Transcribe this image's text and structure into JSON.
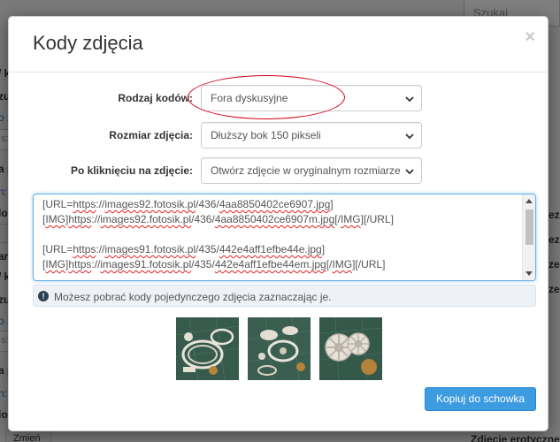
{
  "background": {
    "search_placeholder": "Szukaj",
    "left_items": [
      {
        "text": "/ kod",
        "style": "bold"
      },
      {
        "text": "zuj w",
        "style": "bold"
      },
      {
        "text": "o zd",
        "style": "link"
      },
      {
        "text": "s://w",
        "style": "input"
      },
      {
        "text": "a plik",
        "style": "bold"
      },
      {
        "text": "n: Th",
        "style": "link"
      },
      {
        "text": "loda",
        "style": "bold"
      },
      {
        "text": "Z",
        "style": "plain"
      },
      {
        "text": "ar i",
        "style": "bold"
      },
      {
        "text": "/ ko",
        "style": "bold"
      },
      {
        "text": "zuj w",
        "style": "bold"
      },
      {
        "text": "o zd",
        "style": "link"
      },
      {
        "text": "s://w",
        "style": "input"
      },
      {
        "text": "a plik",
        "style": "bold"
      },
      {
        "text": "n: Th",
        "style": "link"
      },
      {
        "text": "loda",
        "style": "bold"
      },
      {
        "text": "Zmień",
        "style": "button"
      }
    ],
    "right_items": [
      "ez",
      "ezne",
      "ze",
      "ze",
      "Zdjęcie erotyczne"
    ]
  },
  "modal": {
    "title": "Kody zdjęcia",
    "close_label": "×",
    "rows": [
      {
        "label": "Rodzaj kodów:",
        "value": "Fora dyskusyjne"
      },
      {
        "label": "Rozmiar zdjęcia:",
        "value": "Dłuższy bok 150 pikseli"
      },
      {
        "label": "Po kliknięciu na zdjęcie:",
        "value": "Otwórz zdjęcie w oryginalnym rozmiarze"
      }
    ],
    "codes": {
      "lines": [
        [
          "[URL=",
          "https",
          "://",
          "images92.fotosik.pl",
          "/436/",
          "4aa8850402ce6907.jpg",
          "]"
        ],
        [
          "[",
          "IMG",
          "]",
          "https",
          "://",
          "images92.fotosik.pl",
          "/436/",
          "4aa8850402ce6907m.jpg",
          "[/",
          "IMG",
          "][/URL]"
        ],
        [],
        [
          "[URL=",
          "https",
          "://",
          "images91.fotosik.pl",
          "/435/",
          "442e4aff1efbe44e.jpg",
          "]"
        ],
        [
          "[",
          "IMG",
          "]",
          "https",
          "://",
          "images91.fotosik.pl",
          "/435/",
          "442e4aff1efbe44em.jpg",
          "[/",
          "IMG",
          "][/URL]"
        ]
      ]
    },
    "info_icon": "exclamation-icon",
    "info_text": "Możesz pobrać kody pojedynczego zdjęcia zaznaczając je.",
    "copy_button_label": "Kopiuj do schowka",
    "colors": {
      "accent": "#3d9be0",
      "highlight": "#d0021b",
      "focus_border": "#66afe9"
    }
  }
}
